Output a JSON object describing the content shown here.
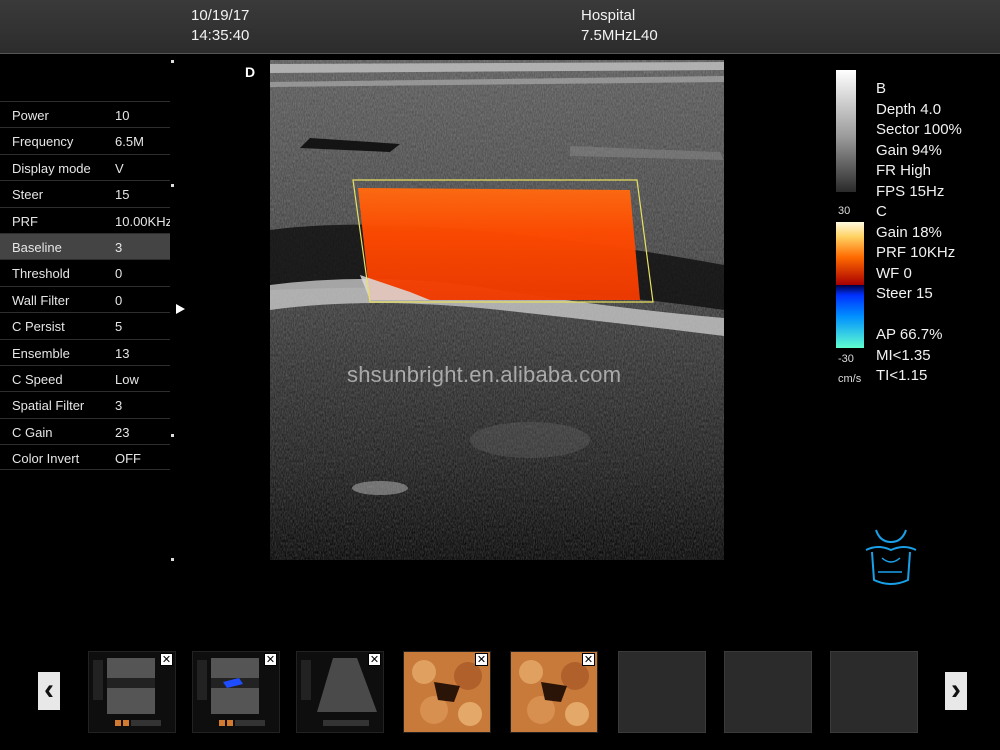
{
  "header": {
    "date": "10/19/17",
    "time": "14:35:40",
    "hospital": "Hospital",
    "probe": "7.5MHzL40"
  },
  "params": [
    {
      "label": "Power",
      "value": "10"
    },
    {
      "label": "Frequency",
      "value": "6.5M"
    },
    {
      "label": "Display mode",
      "value": "V"
    },
    {
      "label": "Steer",
      "value": "15"
    },
    {
      "label": "PRF",
      "value": "10.00KHz"
    },
    {
      "label": "Baseline",
      "value": "3",
      "selected": true
    },
    {
      "label": "Threshold",
      "value": "0"
    },
    {
      "label": "Wall Filter",
      "value": "0"
    },
    {
      "label": "C Persist",
      "value": "5"
    },
    {
      "label": "Ensemble",
      "value": "13"
    },
    {
      "label": "C Speed",
      "value": "Low"
    },
    {
      "label": "Spatial Filter",
      "value": "3"
    },
    {
      "label": "C Gain",
      "value": "23"
    },
    {
      "label": "Color Invert",
      "value": "OFF"
    }
  ],
  "image": {
    "direction_label": "D",
    "watermark": "shsunbright.en.alibaba.com"
  },
  "info": {
    "lines": [
      "B",
      "Depth 4.0",
      "Sector 100%",
      "Gain 94%",
      "FR High",
      "FPS 15Hz",
      "C",
      "Gain  18%",
      "PRF 10KHz",
      "WF 0",
      "Steer 15",
      "",
      "AP 66.7%",
      "MI<1.35",
      "TI<1.15"
    ],
    "scale_max": "30",
    "scale_min": "-30",
    "scale_unit": "cm/s"
  },
  "thumbnails": {
    "prev": "‹",
    "next": "›",
    "close": "✕",
    "items": [
      {
        "kind": "b-mode"
      },
      {
        "kind": "color-doppler"
      },
      {
        "kind": "sector"
      },
      {
        "kind": "3d-render"
      },
      {
        "kind": "3d-render"
      },
      {
        "kind": "empty"
      },
      {
        "kind": "empty"
      },
      {
        "kind": "empty"
      }
    ]
  },
  "colors": {
    "flow_red": "#ff4a00",
    "roi_outline": "#e8e060",
    "selected_row": "#444444"
  }
}
